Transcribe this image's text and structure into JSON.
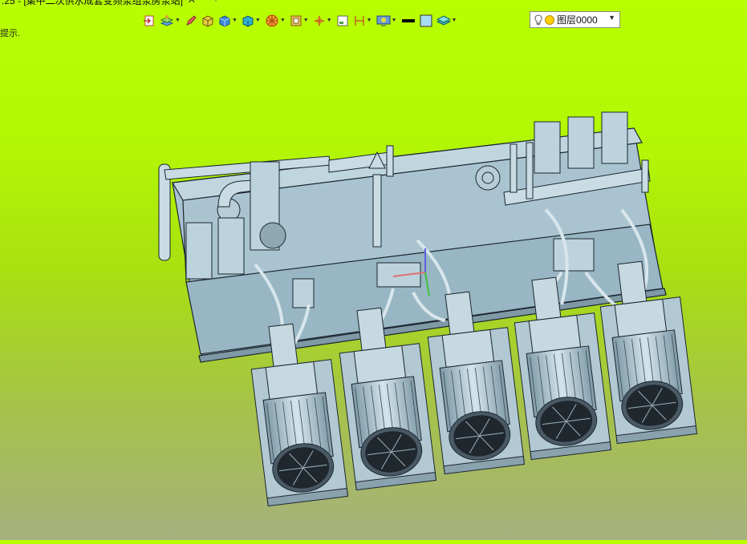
{
  "tab": {
    "title": ".25 - [集中二次供水成套变频泵组泵房泵站]",
    "close": "✕",
    "add": "+"
  },
  "hint": "提示.",
  "toolbar": {
    "icons": [
      "exit-icon",
      "layers-icon",
      "pencil-icon",
      "box-icon",
      "cube-icon",
      "solid-icon",
      "wheel-icon",
      "frame-icon",
      "axis-icon",
      "plane-icon",
      "dimension-icon",
      "display-icon",
      "color-swatch-icon",
      "fill-swatch-icon",
      "layer-stack-icon"
    ]
  },
  "layer": {
    "name": "图层0000",
    "dropdown": "▼"
  },
  "colors": {
    "accent": "#b8ff00",
    "model": "#a8c4d0",
    "lines": "#1c2630"
  }
}
